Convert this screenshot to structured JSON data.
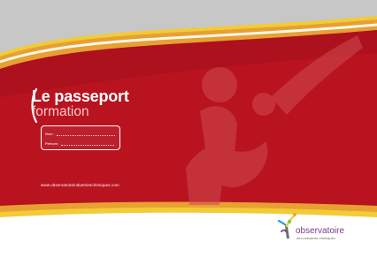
{
  "cover": {
    "title_line1": "Le passeport",
    "title_line2": "formation",
    "form": {
      "name_label": "Nom :",
      "firstname_label": "Prénom :"
    },
    "website": "www.observatoireindustrieschimiques.com"
  },
  "logo": {
    "name": "observatoire",
    "tagline": "des industries chimiques"
  },
  "colors": {
    "band_red": "#b8131f",
    "top_grey": "#c7c7c7",
    "accent_orange": "#e7a032",
    "accent_yellow": "#f2cb37",
    "logo_purple": "#7a3a8a"
  },
  "icons": [
    "bracket-icon",
    "figures-watermark-icon",
    "logo-figure-icon"
  ]
}
